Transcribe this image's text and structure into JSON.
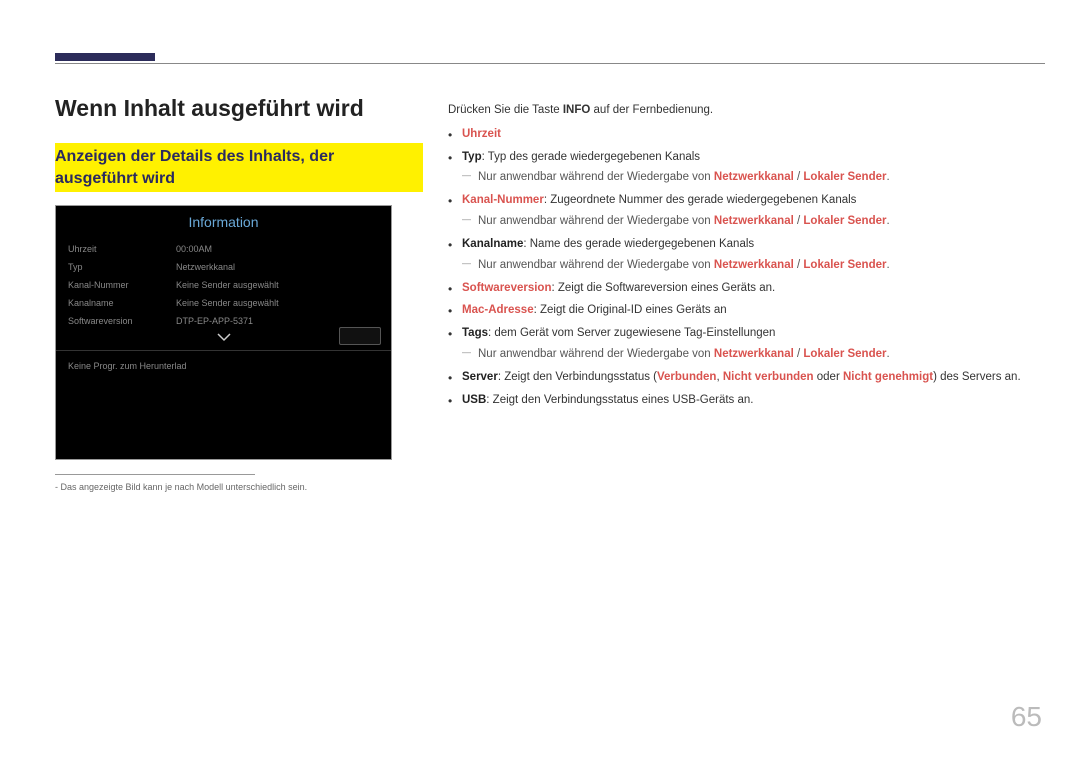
{
  "page_number": "65",
  "title": "Wenn Inhalt ausgeführt wird",
  "subtitle": "Anzeigen der Details des Inhalts, der ausgeführt wird",
  "screenshot": {
    "title": "Information",
    "rows": [
      {
        "label": "Uhrzeit",
        "value": "00:00AM"
      },
      {
        "label": "Typ",
        "value": "Netzwerkkanal"
      },
      {
        "label": "Kanal-Nummer",
        "value": "Keine Sender ausgewählt"
      },
      {
        "label": "Kanalname",
        "value": "Keine Sender ausgewählt"
      },
      {
        "label": "Softwareversion",
        "value": "DTP-EP-APP-5371"
      }
    ],
    "download_msg": "Keine Progr. zum Herunterlad"
  },
  "footnote": "Das angezeigte Bild kann je nach Modell unterschiedlich sein.",
  "intro": {
    "pre": "Drücken Sie die Taste ",
    "bold": "INFO",
    "post": " auf der Fernbedienung."
  },
  "bullets": {
    "uhrzeit": "Uhrzeit",
    "typ_label": "Typ",
    "typ_desc": ": Typ des gerade wiedergegebenen Kanals",
    "note_prefix": "Nur anwendbar während der Wiedergabe von ",
    "note_link1": "Netzwerkkanal",
    "note_sep": " / ",
    "note_link2": "Lokaler Sender",
    "note_end": ".",
    "kanalnummer_label": "Kanal-Nummer",
    "kanalnummer_desc": ": Zugeordnete Nummer des gerade wiedergegebenen Kanals",
    "kanalname_label": "Kanalname",
    "kanalname_desc": ": Name des gerade wiedergegebenen Kanals",
    "swver_label": "Softwareversion",
    "swver_desc": ": Zeigt die Softwareversion eines Geräts an.",
    "mac_label": "Mac-Adresse",
    "mac_desc": ": Zeigt die Original-ID eines Geräts an",
    "tags_label": "Tags",
    "tags_desc": ": dem Gerät vom Server zugewiesene Tag-Einstellungen",
    "server_label": "Server",
    "server_desc1": ": Zeigt den Verbindungsstatus (",
    "server_v1": "Verbunden",
    "server_c1": ", ",
    "server_v2": "Nicht verbunden",
    "server_desc2": " oder ",
    "server_v3": "Nicht genehmigt",
    "server_desc3": ") des Servers an.",
    "usb_label": "USB",
    "usb_desc": ": Zeigt den Verbindungsstatus eines USB-Geräts an."
  }
}
